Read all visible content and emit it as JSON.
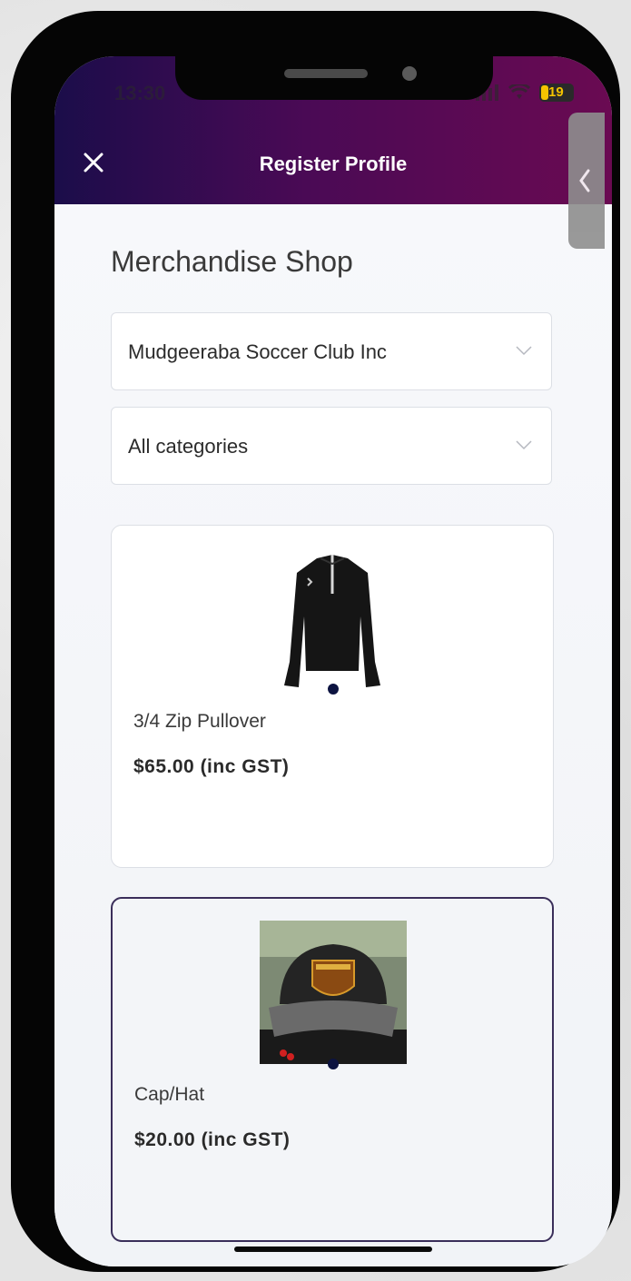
{
  "status_bar": {
    "time": "13:30",
    "battery": "19"
  },
  "header": {
    "title": "Register Profile"
  },
  "main": {
    "heading": "Merchandise Shop",
    "club_select": {
      "value": "Mudgeeraba Soccer Club Inc"
    },
    "category_select": {
      "value": "All categories"
    }
  },
  "products": [
    {
      "name": "3/4 Zip Pullover",
      "price": "$65.00 (inc GST)"
    },
    {
      "name": "Cap/Hat",
      "price": "$20.00 (inc GST)",
      "selected": true
    }
  ],
  "colors": {
    "header_start": "#1b0d4a",
    "header_end": "#6a0a52",
    "selected_border": "#3a2e5a",
    "dot": "#0c1340"
  }
}
